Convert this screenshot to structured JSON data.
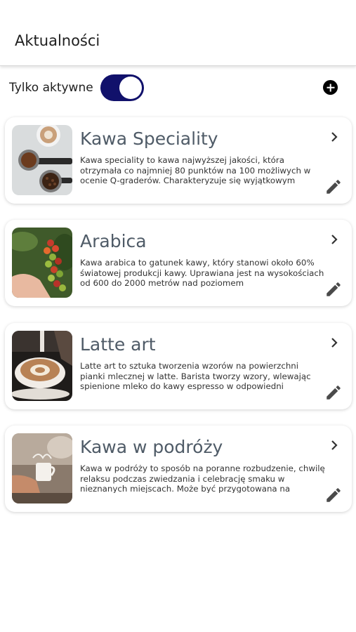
{
  "appbar": {
    "title": "Aktualności"
  },
  "filter": {
    "label": "Tylko aktywne",
    "toggle_on": true,
    "toggle_color": "#11116b"
  },
  "add_icon": "add-circle-icon",
  "chevron_icon": "chevron-right-icon",
  "edit_icon": "pencil-icon",
  "articles": [
    {
      "title": "Kawa Speciality",
      "description": "Kawa speciality to kawa najwyższej jakości, która otrzymała co najmniej 80 punktów na 100 możliwych w ocenie Q-graderów. Charakteryzuje się wyjątkowym"
    },
    {
      "title": "Arabica",
      "description": "Kawa arabica to gatunek kawy, który stanowi około 60% światowej produkcji kawy. Uprawiana jest na wysokościach od 600 do 2000 metrów nad poziomem"
    },
    {
      "title": "Latte art",
      "description": "Latte art to sztuka tworzenia wzorów na powierzchni pianki mlecznej w latte. Barista tworzy wzory, wlewając spienione mleko do kawy espresso w odpowiedni"
    },
    {
      "title": "Kawa w podróży",
      "description": "Kawa w podróży to sposób na poranne rozbudzenie, chwilę relaksu podczas zwiedzania i celebrację smaku w nieznanych miejscach. Może być przygotowana na"
    }
  ]
}
